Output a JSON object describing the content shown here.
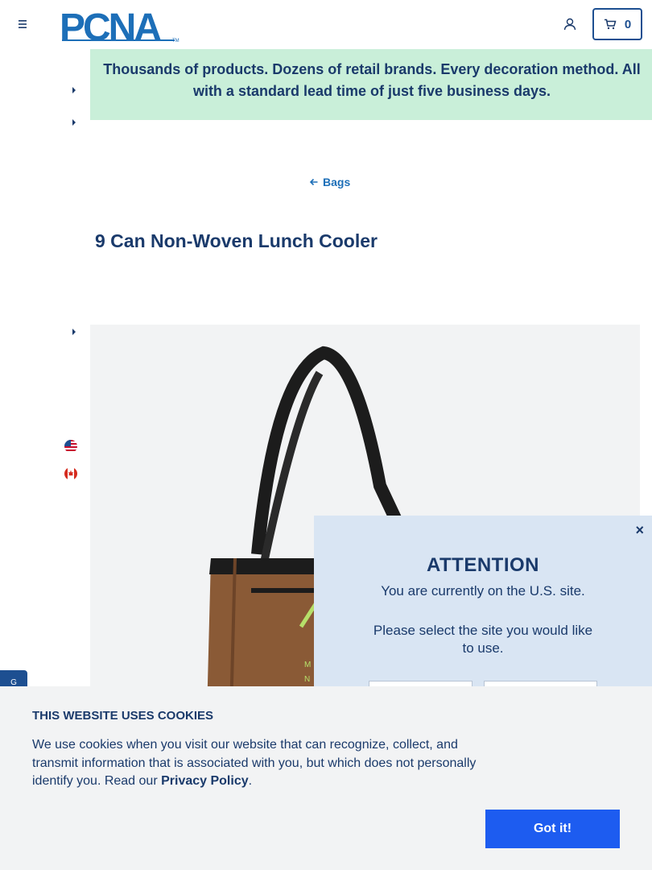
{
  "header": {
    "brand": "PCNA",
    "cart_count": "0"
  },
  "banner": {
    "text": "Thousands of products. Dozens of retail brands. Every decoration method. All with a standard lead time of just five business days."
  },
  "breadcrumb": {
    "label": "Bags"
  },
  "product": {
    "title": "9 Can Non-Woven Lunch Cooler"
  },
  "modal": {
    "close": "×",
    "title": "ATTENTION",
    "line1": "You are currently on the U.S. site.",
    "line2": "Please select the site you would like to use."
  },
  "feedback_tab": {
    "label": "G"
  },
  "cookie": {
    "title": "THIS WEBSITE USES COOKIES",
    "text_before": "We use cookies when you visit our website that can recognize, collect, and transmit information that is associated with you, but which does not personally identify you. Read our ",
    "link": "Privacy Policy",
    "text_after": ".",
    "button": "Got it!"
  },
  "colors": {
    "navy": "#1a3a6b",
    "brand_blue": "#1d4f91",
    "banner_green": "#c9efd9",
    "cookie_button": "#1d5cf0"
  },
  "icons": [
    "hamburger-menu-icon",
    "user-icon",
    "cart-icon",
    "arrow-left-icon",
    "caret-right-icon",
    "us-flag-icon",
    "canada-flag-icon",
    "close-icon"
  ]
}
